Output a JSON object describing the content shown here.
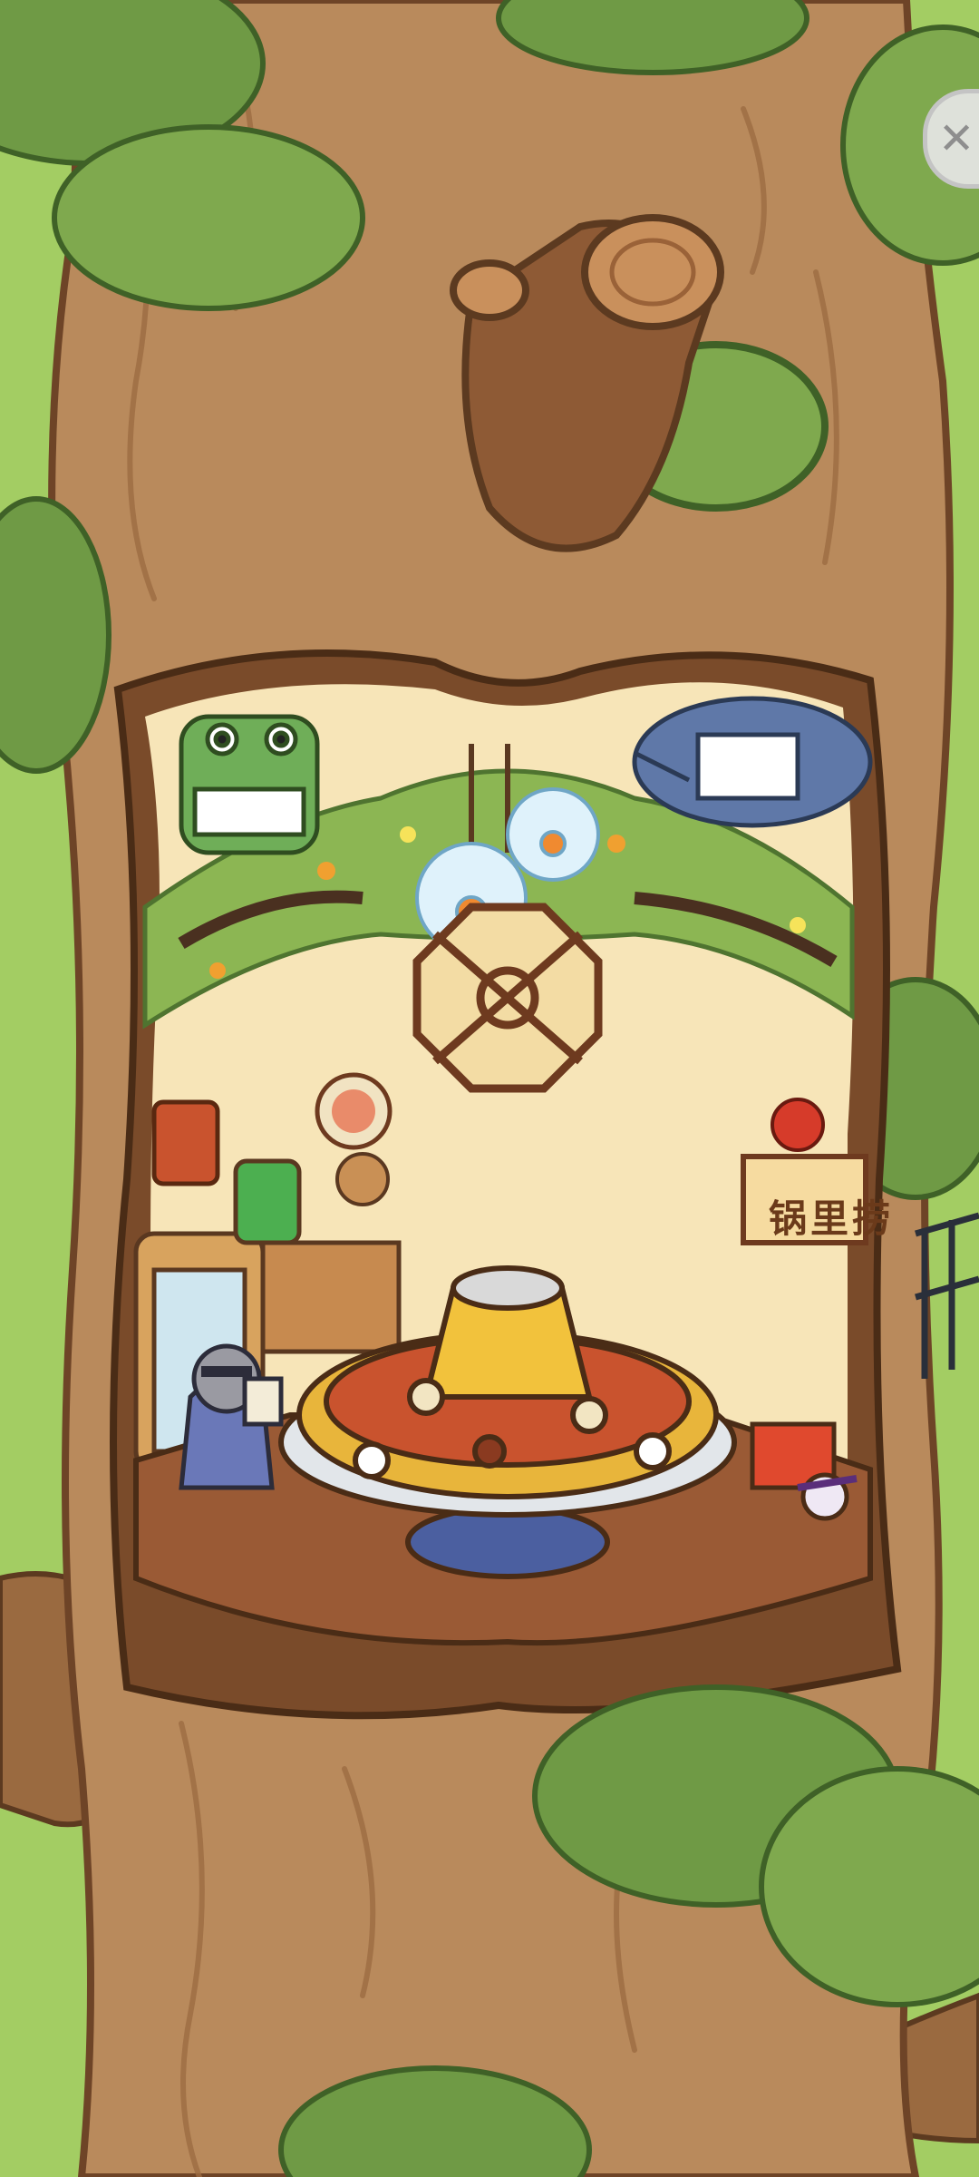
{
  "game": {
    "close_button": {
      "glyph": "✕",
      "icon": "close-icon"
    },
    "shop_sign": {
      "text": "锅里捞"
    },
    "scene": {
      "location": "tree-hollow-hotpot-restaurant",
      "colors": {
        "grass": "#a3cd63",
        "bark": "#b98a5c",
        "bark_dark": "#6e4427",
        "leaf": "#6f9a45",
        "leaf_light": "#8cb653",
        "room_wall": "#f7e5b8",
        "floor": "#9a5a35",
        "pot_gold": "#e8b53b",
        "soup": "#c9532e"
      }
    }
  }
}
